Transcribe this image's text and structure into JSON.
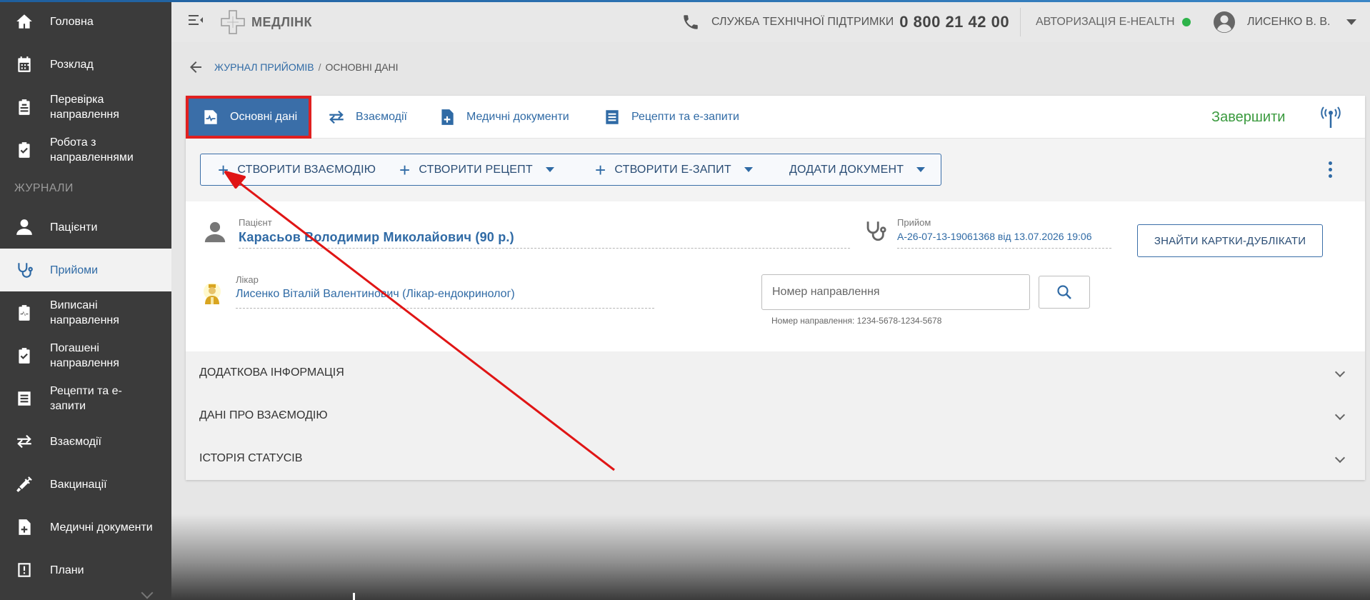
{
  "sidebar": {
    "items_top": [
      {
        "label": "Головна",
        "icon": "home-icon"
      },
      {
        "label": "Розклад",
        "icon": "calendar-icon"
      },
      {
        "label": "Перевірка направлення",
        "icon": "clipboard-icon"
      },
      {
        "label": "Робота з направленнями",
        "icon": "clipboard-check-icon"
      }
    ],
    "section_label": "ЖУРНАЛИ",
    "items_journals": [
      {
        "label": "Пацієнти",
        "icon": "person-icon"
      },
      {
        "label": "Прийоми",
        "icon": "stethoscope-icon"
      },
      {
        "label": "Виписані направлення",
        "icon": "clipboard-pulse-icon"
      },
      {
        "label": "Погашені направлення",
        "icon": "clipboard-check-icon"
      },
      {
        "label": "Рецепти та е-запити",
        "icon": "receipt-icon"
      },
      {
        "label": "Взаємодії",
        "icon": "swap-icon"
      },
      {
        "label": "Вакцинації",
        "icon": "syringe-icon"
      },
      {
        "label": "Медичні документи",
        "icon": "medical-doc-icon"
      },
      {
        "label": "Плани",
        "icon": "plan-icon"
      }
    ]
  },
  "header": {
    "logo_text": "МЕДЛІНК",
    "support_label": "СЛУЖБА ТЕХНІЧНОЇ ПІДТРИМКИ",
    "support_phone": "0 800 21 42 00",
    "auth_label": "АВТОРИЗАЦІЯ E-HEALTH",
    "auth_status_color": "#2eb34a",
    "user_name": "ЛИСЕНКО В. В."
  },
  "breadcrumb": {
    "link": "ЖУРНАЛ ПРИЙОМІВ",
    "separator": "/",
    "current": "ОСНОВНІ ДАНІ"
  },
  "tabs": [
    {
      "label": "Основні дані",
      "icon": "heart-doc-icon",
      "active": true
    },
    {
      "label": "Взаємодії",
      "icon": "swap-icon"
    },
    {
      "label": "Медичні документи",
      "icon": "medical-doc-icon"
    },
    {
      "label": "Рецепти та е-запити",
      "icon": "receipt-icon"
    }
  ],
  "finish_label": "Завершити",
  "toolbar": {
    "create_interaction": "СТВОРИТИ ВЗАЄМОДІЮ",
    "create_recipe": "СТВОРИТИ РЕЦЕПТ",
    "create_erequest": "СТВОРИТИ Е-ЗАПИТ",
    "add_document": "ДОДАТИ ДОКУМЕНТ"
  },
  "patient": {
    "label": "Пацієнт",
    "name": "Карасьов Володимир Миколайович (90 р.)"
  },
  "visit": {
    "label": "Прийом",
    "value": "А-26-07-13-19061368 від 13.07.2026 19:06"
  },
  "find_duplicates_label": "ЗНАЙТИ КАРТКИ-ДУБЛІКАТИ",
  "doctor": {
    "label": "Лікар",
    "name": "Лисенко Віталій Валентинович (Лікар-ендокринолог)"
  },
  "referral": {
    "placeholder": "Номер направлення",
    "hint": "Номер направлення: 1234-5678-1234-5678"
  },
  "accordion": [
    "ДОДАТКОВА ІНФОРМАЦІЯ",
    "ДАНІ ПРО ВЗАЄМОДІЮ",
    "ІСТОРІЯ СТАТУСІВ"
  ],
  "colors": {
    "accent": "#2f6aa5",
    "sidebar_bg": "#3b3b3b",
    "finish": "#3a9a3e",
    "highlight": "#e02020"
  }
}
